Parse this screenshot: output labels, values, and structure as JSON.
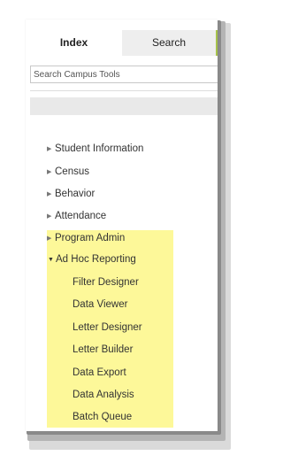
{
  "tabs": {
    "index_label": "Index",
    "search_label": "Search"
  },
  "search": {
    "placeholder": "Search Campus Tools"
  },
  "icons": {
    "collapsed_arrow": "triangle-right-icon",
    "expanded_arrow": "triangle-down-icon"
  },
  "colors": {
    "highlight": "#fdf899",
    "tab_accent": "#a6c24a",
    "inactive_tab": "#eeeeee"
  },
  "nav": {
    "items": [
      {
        "label": "Student Information",
        "expanded": false
      },
      {
        "label": "Census",
        "expanded": false
      },
      {
        "label": "Behavior",
        "expanded": false
      },
      {
        "label": "Attendance",
        "expanded": false
      },
      {
        "label": "Program Admin",
        "expanded": false
      },
      {
        "label": "Ad Hoc Reporting",
        "expanded": true
      }
    ],
    "ad_hoc_children": [
      "Filter Designer",
      "Data Viewer",
      "Letter Designer",
      "Letter Builder",
      "Data Export",
      "Data Analysis",
      "Batch Queue"
    ]
  }
}
